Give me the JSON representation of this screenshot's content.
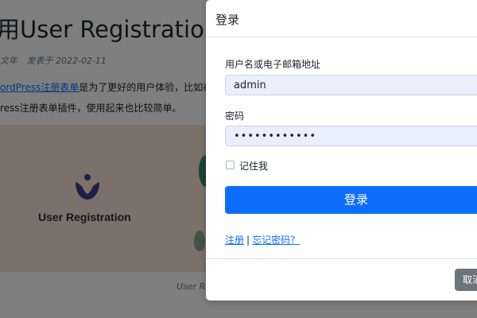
{
  "article": {
    "title": "用User Registration建立",
    "meta_author": "文年",
    "meta_date": "发表于 2022-02-11",
    "p1_link": "ordPress注册表单",
    "p1_rest": "是为了更好的用户体验，比如在网",
    "p2": "ress注册表单插件，使用起来也比较简单。",
    "image_brand": "User Registration",
    "caption": "User Re"
  },
  "modal": {
    "title": "登录",
    "username_label": "用户名或电子邮箱地址",
    "username_value": "admin",
    "password_label": "密码",
    "password_value": "••••••••••••",
    "remember_label": "记住我",
    "login_button": "登录",
    "register_link": "注册",
    "separator": "|",
    "forgot_link": "忘记密码？",
    "cancel_button": "取消"
  },
  "colors": {
    "primary": "#0d6efd",
    "input_bg": "#e8f0fe",
    "cancel_bg": "#6c757d",
    "featured_bg": "#f6e0d4",
    "overlay": "rgba(0,0,0,0.5)"
  },
  "icons": {
    "logo": "user-registration-logo-icon"
  }
}
